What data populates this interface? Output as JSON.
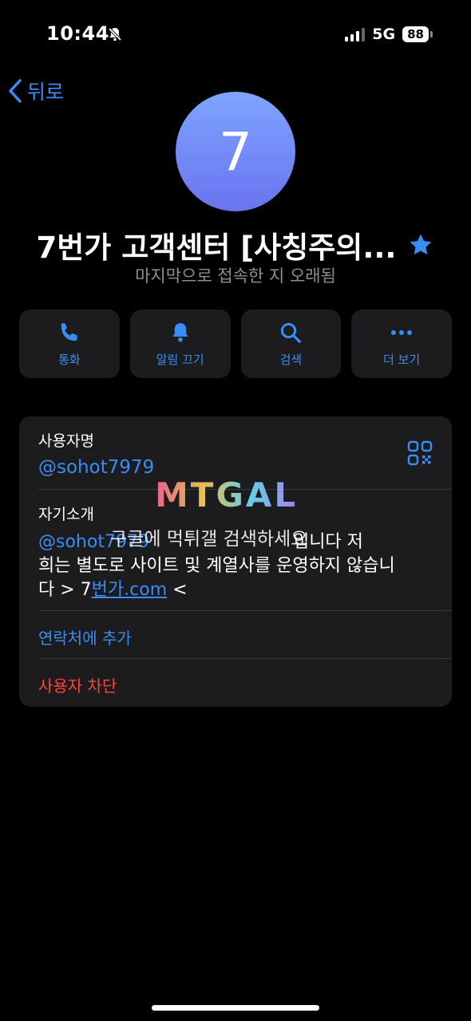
{
  "status": {
    "time": "10:44",
    "network": "5G",
    "battery": "88"
  },
  "nav": {
    "back_label": "뒤로"
  },
  "profile": {
    "avatar_letter": "7",
    "name": "7번가 고객센터 [사칭주의...",
    "last_seen": "마지막으로 접속한 지 오래됨"
  },
  "actions": {
    "call": "통화",
    "mute": "알림 끄기",
    "search": "검색",
    "more": "더 보기"
  },
  "info": {
    "username_label": "사용자명",
    "username": "@sohot7979",
    "bio_label": "자기소개",
    "bio_line1": "@sohot7979",
    "bio_line1_tail": "입니다 저",
    "bio_line2": "희는 별도로 사이트 및 계열사를 운영하지 않습니",
    "bio_line3_pre": "다 > 7",
    "bio_link": "번가.com",
    "bio_line3_post": " <",
    "add_contact": "연락처에 추가",
    "block_user": "사용자 차단"
  },
  "watermark": {
    "logo": "MTGAL",
    "text": "구글에 먹튀갤 검색하세요"
  },
  "colors": {
    "accent": "#3a8df5",
    "danger": "#ff453a",
    "card": "#1c1c1e",
    "star": "#3a8df5"
  }
}
